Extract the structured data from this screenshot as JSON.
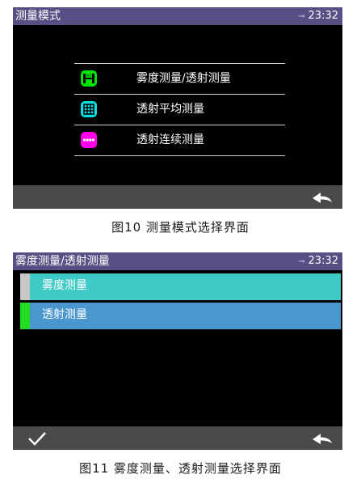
{
  "screen1": {
    "title": "测量模式",
    "time": "23:32",
    "menu": [
      {
        "label": "雾度测量/透射测量",
        "icon": "haze-transmission-mode-icon",
        "color": "#00e400"
      },
      {
        "label": "透射平均测量",
        "icon": "average-grid-icon",
        "color": "#00e0e6"
      },
      {
        "label": "透射连续测量",
        "icon": "continuous-dots-icon",
        "color": "#ff00e8"
      }
    ],
    "bottom_bar": {
      "back_icon": "back-arrow-icon"
    }
  },
  "caption1": "图10 测量模式选择界面",
  "screen2": {
    "title": "雾度测量/透射测量",
    "time": "23:32",
    "options": [
      {
        "label": "雾度测量",
        "marker_color": "#c8c8c8",
        "bg": "#3fcac5"
      },
      {
        "label": "透射测量",
        "marker_color": "#22dd22",
        "bg": "#4a97d0"
      }
    ],
    "bottom_bar": {
      "confirm_icon": "checkmark-icon",
      "back_icon": "back-arrow-icon"
    }
  },
  "caption2": "图11 雾度测量、透射测量选择界面"
}
